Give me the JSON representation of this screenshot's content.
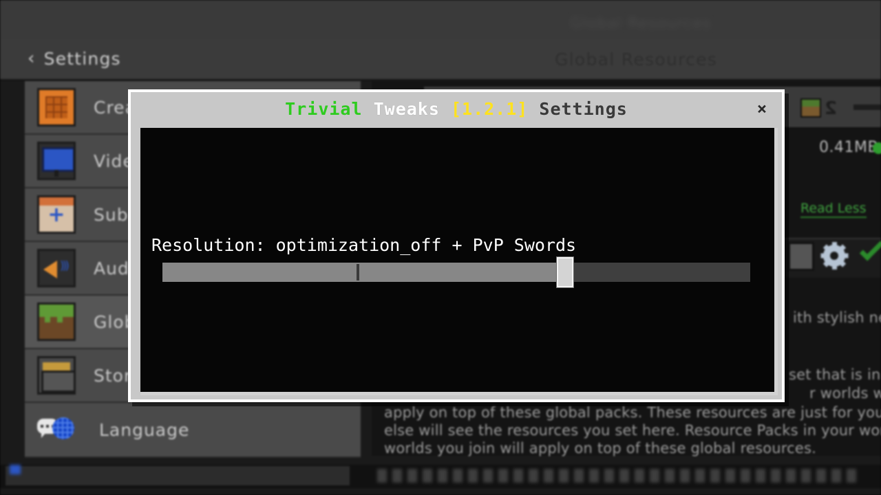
{
  "background": {
    "back_button": {
      "icon": "chevron-left-icon",
      "label": "Settings"
    },
    "page_heading": "Global Resources",
    "sidebar": {
      "items": [
        {
          "label": "Crea",
          "icon": "crafting-table-icon",
          "selected": false
        },
        {
          "label": "Vide",
          "icon": "video-monitor-icon",
          "selected": false
        },
        {
          "label": "Subs",
          "icon": "subscription-plus-icon",
          "selected": false
        },
        {
          "label": "Audi",
          "icon": "audio-speaker-icon",
          "selected": false
        },
        {
          "label": "Glob",
          "icon": "grass-block-icon",
          "selected": true
        },
        {
          "label": "Stor",
          "icon": "storage-drawer-icon",
          "selected": false
        },
        {
          "label": "Language",
          "icon": "language-globe-icon",
          "selected": false
        }
      ]
    },
    "detail": {
      "pack_count": "2",
      "pack_size": "0.41MB",
      "status_dot_color": "#2e9e2e",
      "read_less": "Read Less",
      "read_less_color": "#3fa33f",
      "desc_fragments": [
        "ith stylish new",
        "set that is in",
        "r worlds will",
        "apply on top of these global packs. These resources are just for you. No one",
        "else will see the resources you set here. Resource Packs in your worlds or",
        "worlds you join will apply on top of these global resources."
      ],
      "controls": {
        "swatch": "color-swatch",
        "gear": "gear-icon",
        "check": "green-check-icon"
      }
    }
  },
  "dialog": {
    "title": {
      "part_green": "Trivial",
      "part_white": "Tweaks",
      "part_yellow": "[1.2.1]",
      "part_dark": "Settings",
      "color_green": "#2ecc1f",
      "color_white": "#ffffff",
      "color_yellow": "#ffe21f",
      "color_dark": "#3a3a3a"
    },
    "close_label": "×",
    "setting": {
      "label": "Resolution: optimization_off + PvP Swords",
      "slider": {
        "fill_percent": 68.5,
        "handle_percent": 68.5,
        "tick_percent": 33
      }
    }
  }
}
